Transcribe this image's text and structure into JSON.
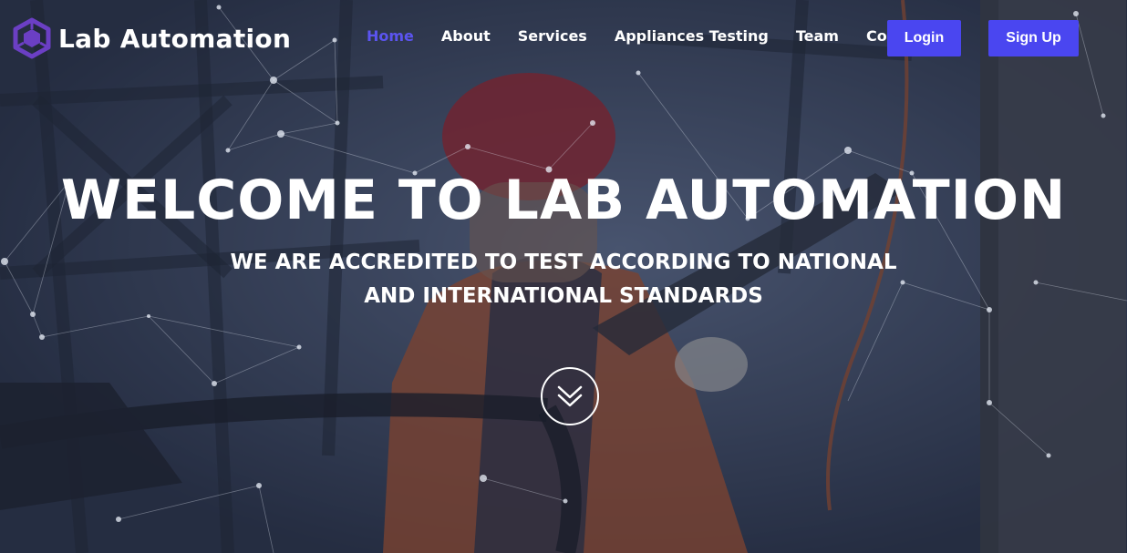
{
  "brand": {
    "name": "Lab Automation",
    "logo_icon": "cube-logo-icon",
    "logo_color": "#6b3fc4"
  },
  "nav": {
    "links": [
      {
        "label": "Home",
        "active": true
      },
      {
        "label": "About",
        "active": false
      },
      {
        "label": "Services",
        "active": false
      },
      {
        "label": "Appliances Testing",
        "active": false
      },
      {
        "label": "Team",
        "active": false
      },
      {
        "label": "Contact",
        "active": false
      }
    ],
    "login_label": "Login",
    "signup_label": "Sign Up",
    "active_color": "#5b54f0",
    "button_color": "#4a46f0"
  },
  "hero": {
    "title": "WELCOME TO LAB AUTOMATION",
    "subtitle_line1": "WE ARE ACCREDITED TO TEST ACCORDING TO NATIONAL",
    "subtitle_line2": "AND INTERNATIONAL STANDARDS",
    "scroll_icon": "double-chevron-down-icon"
  }
}
